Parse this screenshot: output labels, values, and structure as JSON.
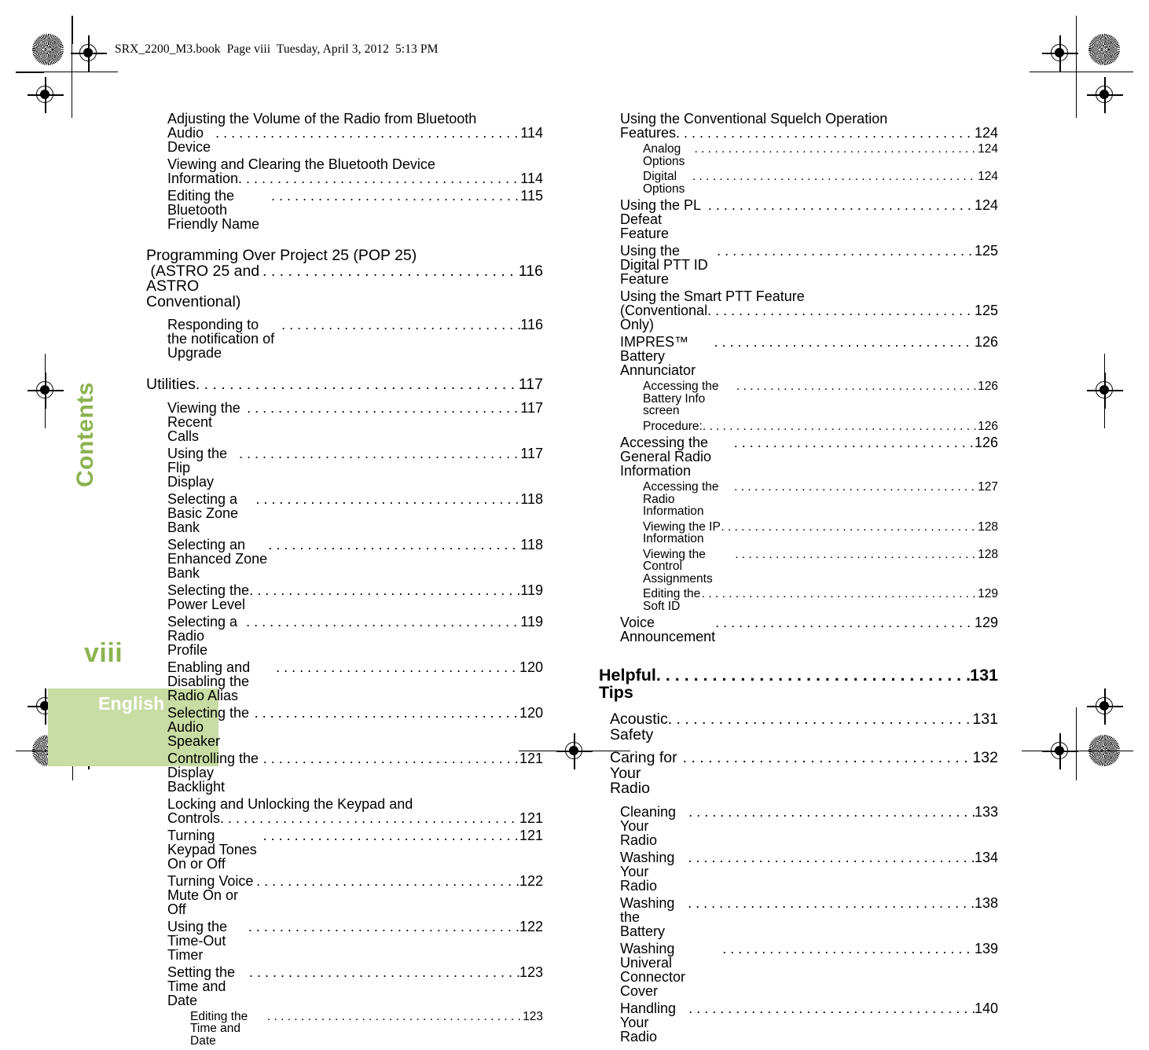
{
  "header": {
    "slug": "SRX_2200_M3.book  Page viii  Tuesday, April 3, 2012  5:13 PM"
  },
  "sidebar": {
    "tab_label": "Contents",
    "page_number": "viii",
    "language_label": "English",
    "accent_color": "#8CB350",
    "box_color": "#C8DCA4"
  },
  "columns": {
    "left": [
      {
        "level": 2,
        "title": "Adjusting the Volume of the Radio from Bluetooth\nAudio Device",
        "page": "114"
      },
      {
        "level": 2,
        "title": "Viewing and Clearing the Bluetooth Device\nInformation",
        "page": "114"
      },
      {
        "level": 2,
        "title": "Editing the Bluetooth Friendly Name",
        "page": "115"
      },
      {
        "level": 1,
        "gap": "md",
        "title": "Programming Over Project 25 (POP 25)\n (ASTRO 25 and ASTRO Conventional)",
        "page": "116"
      },
      {
        "level": 2,
        "title": "Responding to the notification of Upgrade",
        "page": "116"
      },
      {
        "level": 1,
        "gap": "md",
        "title": "Utilities",
        "page": "117"
      },
      {
        "level": 2,
        "title": "Viewing the Recent Calls",
        "page": "117"
      },
      {
        "level": 2,
        "title": "Using the Flip Display",
        "page": "117"
      },
      {
        "level": 2,
        "title": "Selecting a Basic Zone Bank",
        "page": "118"
      },
      {
        "level": 2,
        "title": "Selecting an Enhanced Zone Bank",
        "page": "118"
      },
      {
        "level": 2,
        "title": "Selecting the Power Level",
        "page": "119"
      },
      {
        "level": 2,
        "title": "Selecting a Radio Profile",
        "page": "119"
      },
      {
        "level": 2,
        "title": "Enabling and Disabling the Radio Alias",
        "page": "120"
      },
      {
        "level": 2,
        "title": "Selecting the Audio Speaker",
        "page": "120"
      },
      {
        "level": 2,
        "title": "Controlling the Display Backlight",
        "page": "121"
      },
      {
        "level": 2,
        "title": "Locking and Unlocking the Keypad and\nControls",
        "page": "121"
      },
      {
        "level": 2,
        "title": "Turning Keypad Tones On or Off",
        "page": "121"
      },
      {
        "level": 2,
        "title": "Turning Voice Mute On or Off",
        "page": "122"
      },
      {
        "level": 2,
        "title": "Using the Time-Out Timer",
        "page": "122"
      },
      {
        "level": 2,
        "title": "Setting the Time and Date",
        "page": "123"
      },
      {
        "level": 3,
        "title": "Editing the Time and Date",
        "page": "123"
      }
    ],
    "right": [
      {
        "level": 2,
        "title": "Using the Conventional Squelch Operation\nFeatures",
        "page": "124"
      },
      {
        "level": 3,
        "title": "Analog Options",
        "page": "124"
      },
      {
        "level": 3,
        "title": "Digital Options",
        "page": "124"
      },
      {
        "level": 2,
        "title": "Using the PL Defeat Feature",
        "page": "124"
      },
      {
        "level": 2,
        "title": "Using the Digital PTT ID Feature",
        "page": "125"
      },
      {
        "level": 2,
        "title": "Using the Smart PTT Feature\n(Conventional Only)",
        "page": "125"
      },
      {
        "level": 2,
        "title": "IMPRES™ Battery Annunciator",
        "page": "126"
      },
      {
        "level": 3,
        "title": "Accessing the Battery Info screen",
        "page": "126"
      },
      {
        "level": 3,
        "title": "Procedure:",
        "page": "126"
      },
      {
        "level": 2,
        "title": "Accessing the General Radio Information",
        "page": "126"
      },
      {
        "level": 3,
        "title": "Accessing the Radio Information",
        "page": "127"
      },
      {
        "level": 3,
        "title": "Viewing the IP Information",
        "page": "128"
      },
      {
        "level": 3,
        "title": "Viewing the Control Assignments",
        "page": "128"
      },
      {
        "level": 3,
        "title": "Editing the Soft ID",
        "page": "129"
      },
      {
        "level": 2,
        "title": "Voice Announcement",
        "page": "129"
      },
      {
        "level": "1b",
        "gap": "lg",
        "title": "Helpful Tips",
        "page": "131"
      },
      {
        "level": "1c",
        "gap": "sm",
        "title": "Acoustic Safety",
        "page": "131"
      },
      {
        "level": "1c",
        "title": "Caring for Your Radio",
        "page": "132"
      },
      {
        "level": 2,
        "title": "Cleaning Your Radio",
        "page": "133"
      },
      {
        "level": 2,
        "title": "Washing Your Radio",
        "page": "134"
      },
      {
        "level": 2,
        "title": "Washing the Battery",
        "page": "138"
      },
      {
        "level": 2,
        "title": "Washing Univeral Connector Cover",
        "page": "139"
      },
      {
        "level": 2,
        "title": "Handling Your Radio",
        "page": "140"
      }
    ]
  }
}
